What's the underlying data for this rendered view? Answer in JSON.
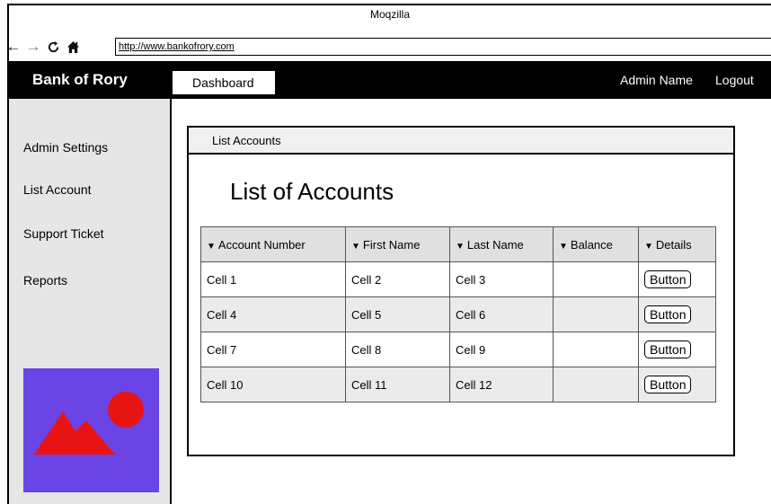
{
  "browser": {
    "title": "Moqzilla",
    "url": "http://www.bankofrory.com"
  },
  "topbar": {
    "brand": "Bank of Rory",
    "tab_dashboard": "Dashboard",
    "admin_name": "Admin Name",
    "logout": "Logout"
  },
  "sidebar": {
    "items": [
      {
        "label": "Admin Settings"
      },
      {
        "label": "List Account"
      },
      {
        "label": "Support Ticket"
      },
      {
        "label": "Reports"
      }
    ]
  },
  "panel": {
    "header": "List Accounts",
    "title": "List of Accounts"
  },
  "table": {
    "columns": [
      "Account Number",
      "First Name",
      "Last Name",
      "Balance",
      "Details"
    ],
    "rows": [
      {
        "account": "Cell 1",
        "first": "Cell 2",
        "last": "Cell 3",
        "balance": "",
        "button": "Button"
      },
      {
        "account": "Cell 4",
        "first": "Cell 5",
        "last": "Cell 6",
        "balance": "",
        "button": "Button"
      },
      {
        "account": "Cell 7",
        "first": "Cell 8",
        "last": "Cell 9",
        "balance": "",
        "button": "Button"
      },
      {
        "account": "Cell 10",
        "first": "Cell 11",
        "last": "Cell 12",
        "balance": "",
        "button": "Button"
      }
    ]
  },
  "colors": {
    "image_bg": "#6a44e5",
    "image_shape": "#e81414",
    "topbar_bg": "#000000",
    "sidebar_bg": "#e6e6e6"
  },
  "icons": {
    "back": "arrow-left-icon",
    "forward": "arrow-right-icon",
    "reload": "reload-icon",
    "home": "home-icon",
    "sort": "caret-down-icon",
    "image": "image-placeholder-icon"
  }
}
